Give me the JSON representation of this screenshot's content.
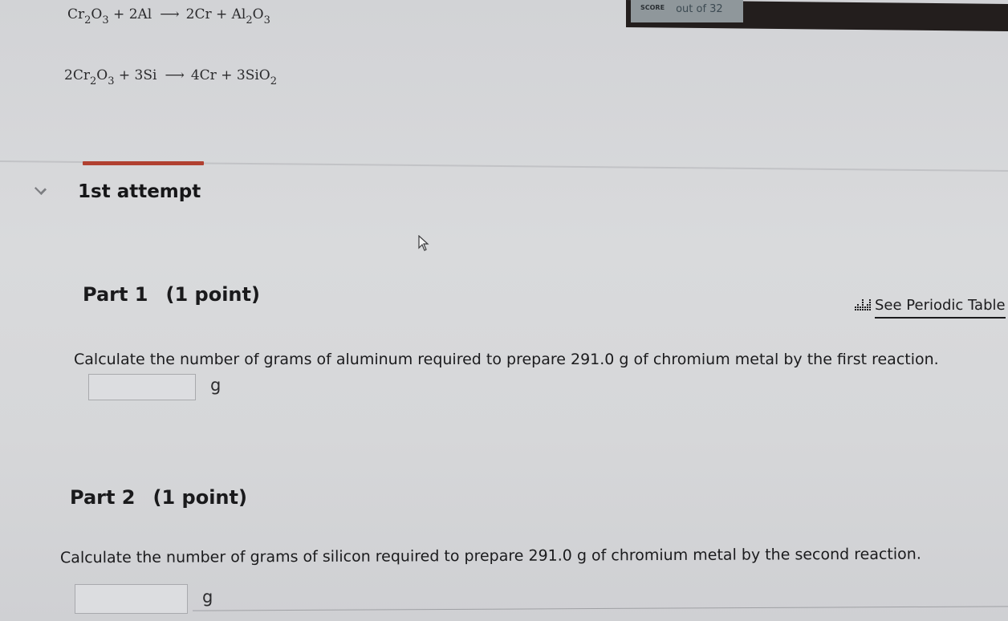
{
  "header": {
    "score_label": "SCORE",
    "score_text": "out of 32"
  },
  "equations": [
    {
      "reactants": [
        {
          "coef": "",
          "parts": [
            [
              "Cr",
              ""
            ],
            [
              "",
              "2"
            ],
            [
              "O",
              ""
            ],
            [
              "",
              "3"
            ]
          ]
        },
        {
          "coef": "2",
          "parts": [
            [
              "Al",
              ""
            ]
          ]
        }
      ],
      "products": [
        {
          "coef": "2",
          "parts": [
            [
              "Cr",
              ""
            ]
          ]
        },
        {
          "coef": "",
          "parts": [
            [
              "Al",
              ""
            ],
            [
              "",
              "2"
            ],
            [
              "O",
              ""
            ],
            [
              "",
              "3"
            ]
          ]
        }
      ]
    },
    {
      "reactants": [
        {
          "coef": "2",
          "parts": [
            [
              "Cr",
              ""
            ],
            [
              "",
              "2"
            ],
            [
              "O",
              ""
            ],
            [
              "",
              "3"
            ]
          ]
        },
        {
          "coef": "3",
          "parts": [
            [
              "Si",
              ""
            ]
          ]
        }
      ],
      "products": [
        {
          "coef": "4",
          "parts": [
            [
              "Cr",
              ""
            ]
          ]
        },
        {
          "coef": "3",
          "parts": [
            [
              "SiO",
              ""
            ],
            [
              "",
              "2"
            ]
          ]
        }
      ]
    }
  ],
  "symbols": {
    "plus": "+",
    "arrow": "⟶"
  },
  "attempt": {
    "title": "1st attempt",
    "expanded": true
  },
  "colors": {
    "accent": "#b14030",
    "topbar": "#231e1d",
    "score_box": "#8f979b"
  },
  "periodic_table_link": {
    "label": "See Periodic Table",
    "icon": "periodic-table-icon"
  },
  "parts": [
    {
      "title": "Part 1",
      "points": "(1 point)",
      "question": "Calculate the number of grams of aluminum required to prepare 291.0 g of chromium metal by the first reaction.",
      "answer_value": "",
      "unit": "g"
    },
    {
      "title": "Part 2",
      "points": "(1 point)",
      "question": "Calculate the number of grams of silicon required to prepare 291.0 g of chromium metal by the second reaction.",
      "answer_value": "",
      "unit": "g"
    }
  ]
}
